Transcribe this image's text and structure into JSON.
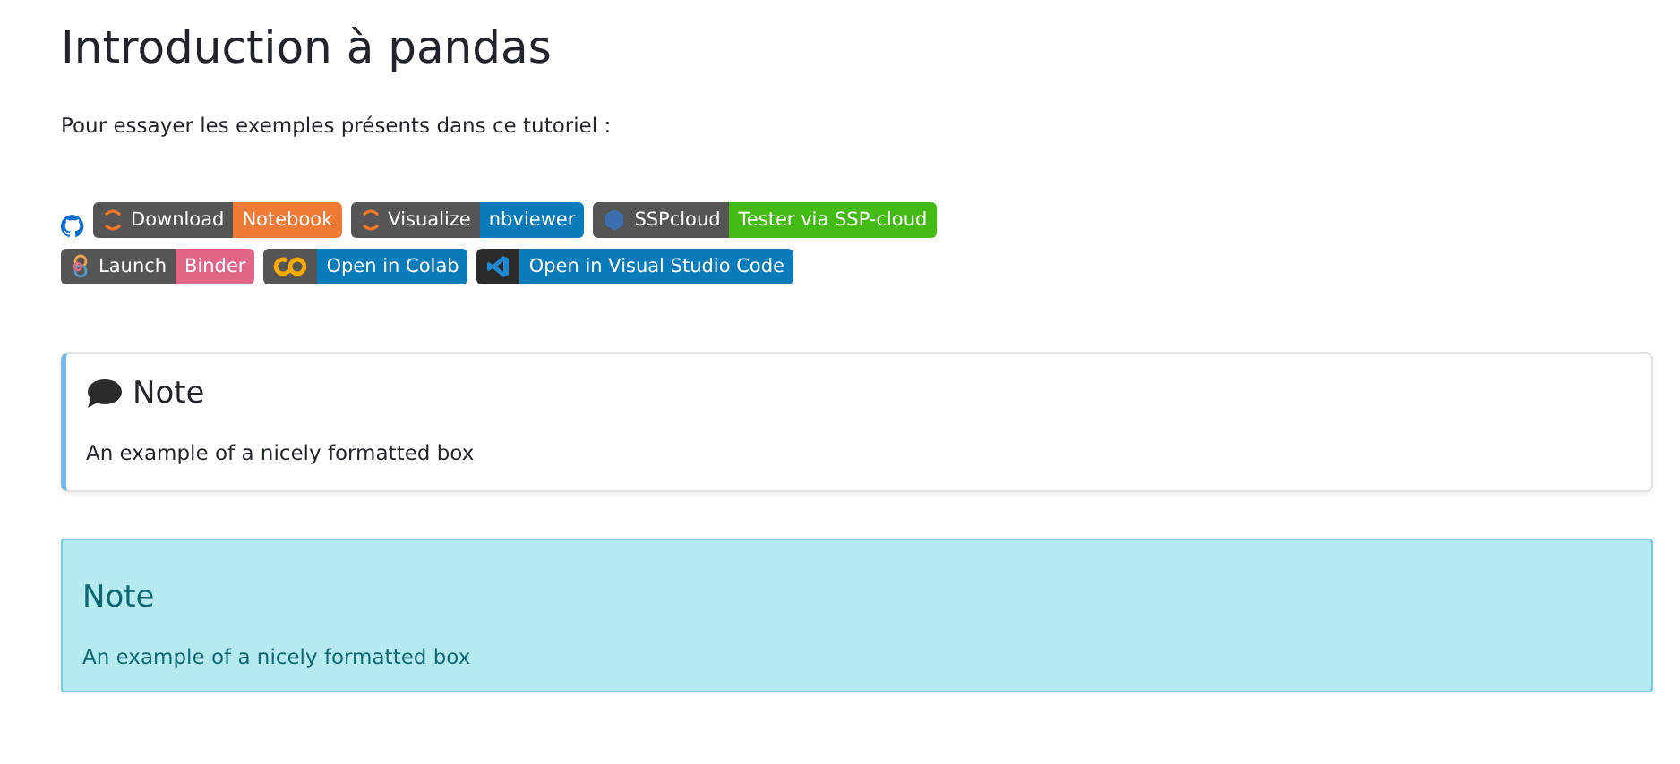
{
  "title": "Introduction à pandas",
  "intro": "Pour essayer les exemples présents dans ce tutoriel :",
  "badge_rows": [
    {
      "badges": [
        {
          "kind": "jupyter",
          "label": "Download",
          "message": "Notebook",
          "color": "#f07b37"
        },
        {
          "kind": "jupyter",
          "label": "Visualize",
          "message": "nbviewer",
          "color": "#0a7bbb"
        },
        {
          "kind": "ssp",
          "label": "SSPcloud",
          "message": "Tester via SSP-cloud",
          "color": "#44bb14"
        }
      ]
    },
    {
      "badges": [
        {
          "kind": "binder",
          "label": "Launch",
          "message": "Binder",
          "color": "#e06586"
        },
        {
          "kind": "colab",
          "message": "Open in Colab",
          "color": "#0a7bbb"
        },
        {
          "kind": "vscode",
          "message": "Open in Visual Studio Code",
          "color": "#0a7bbb"
        }
      ]
    }
  ],
  "notes": [
    {
      "kind": "card",
      "title": "Note",
      "body": "An example of a nicely formatted box"
    },
    {
      "kind": "alert",
      "title": "Note",
      "body": "An example of a nicely formatted box"
    }
  ]
}
